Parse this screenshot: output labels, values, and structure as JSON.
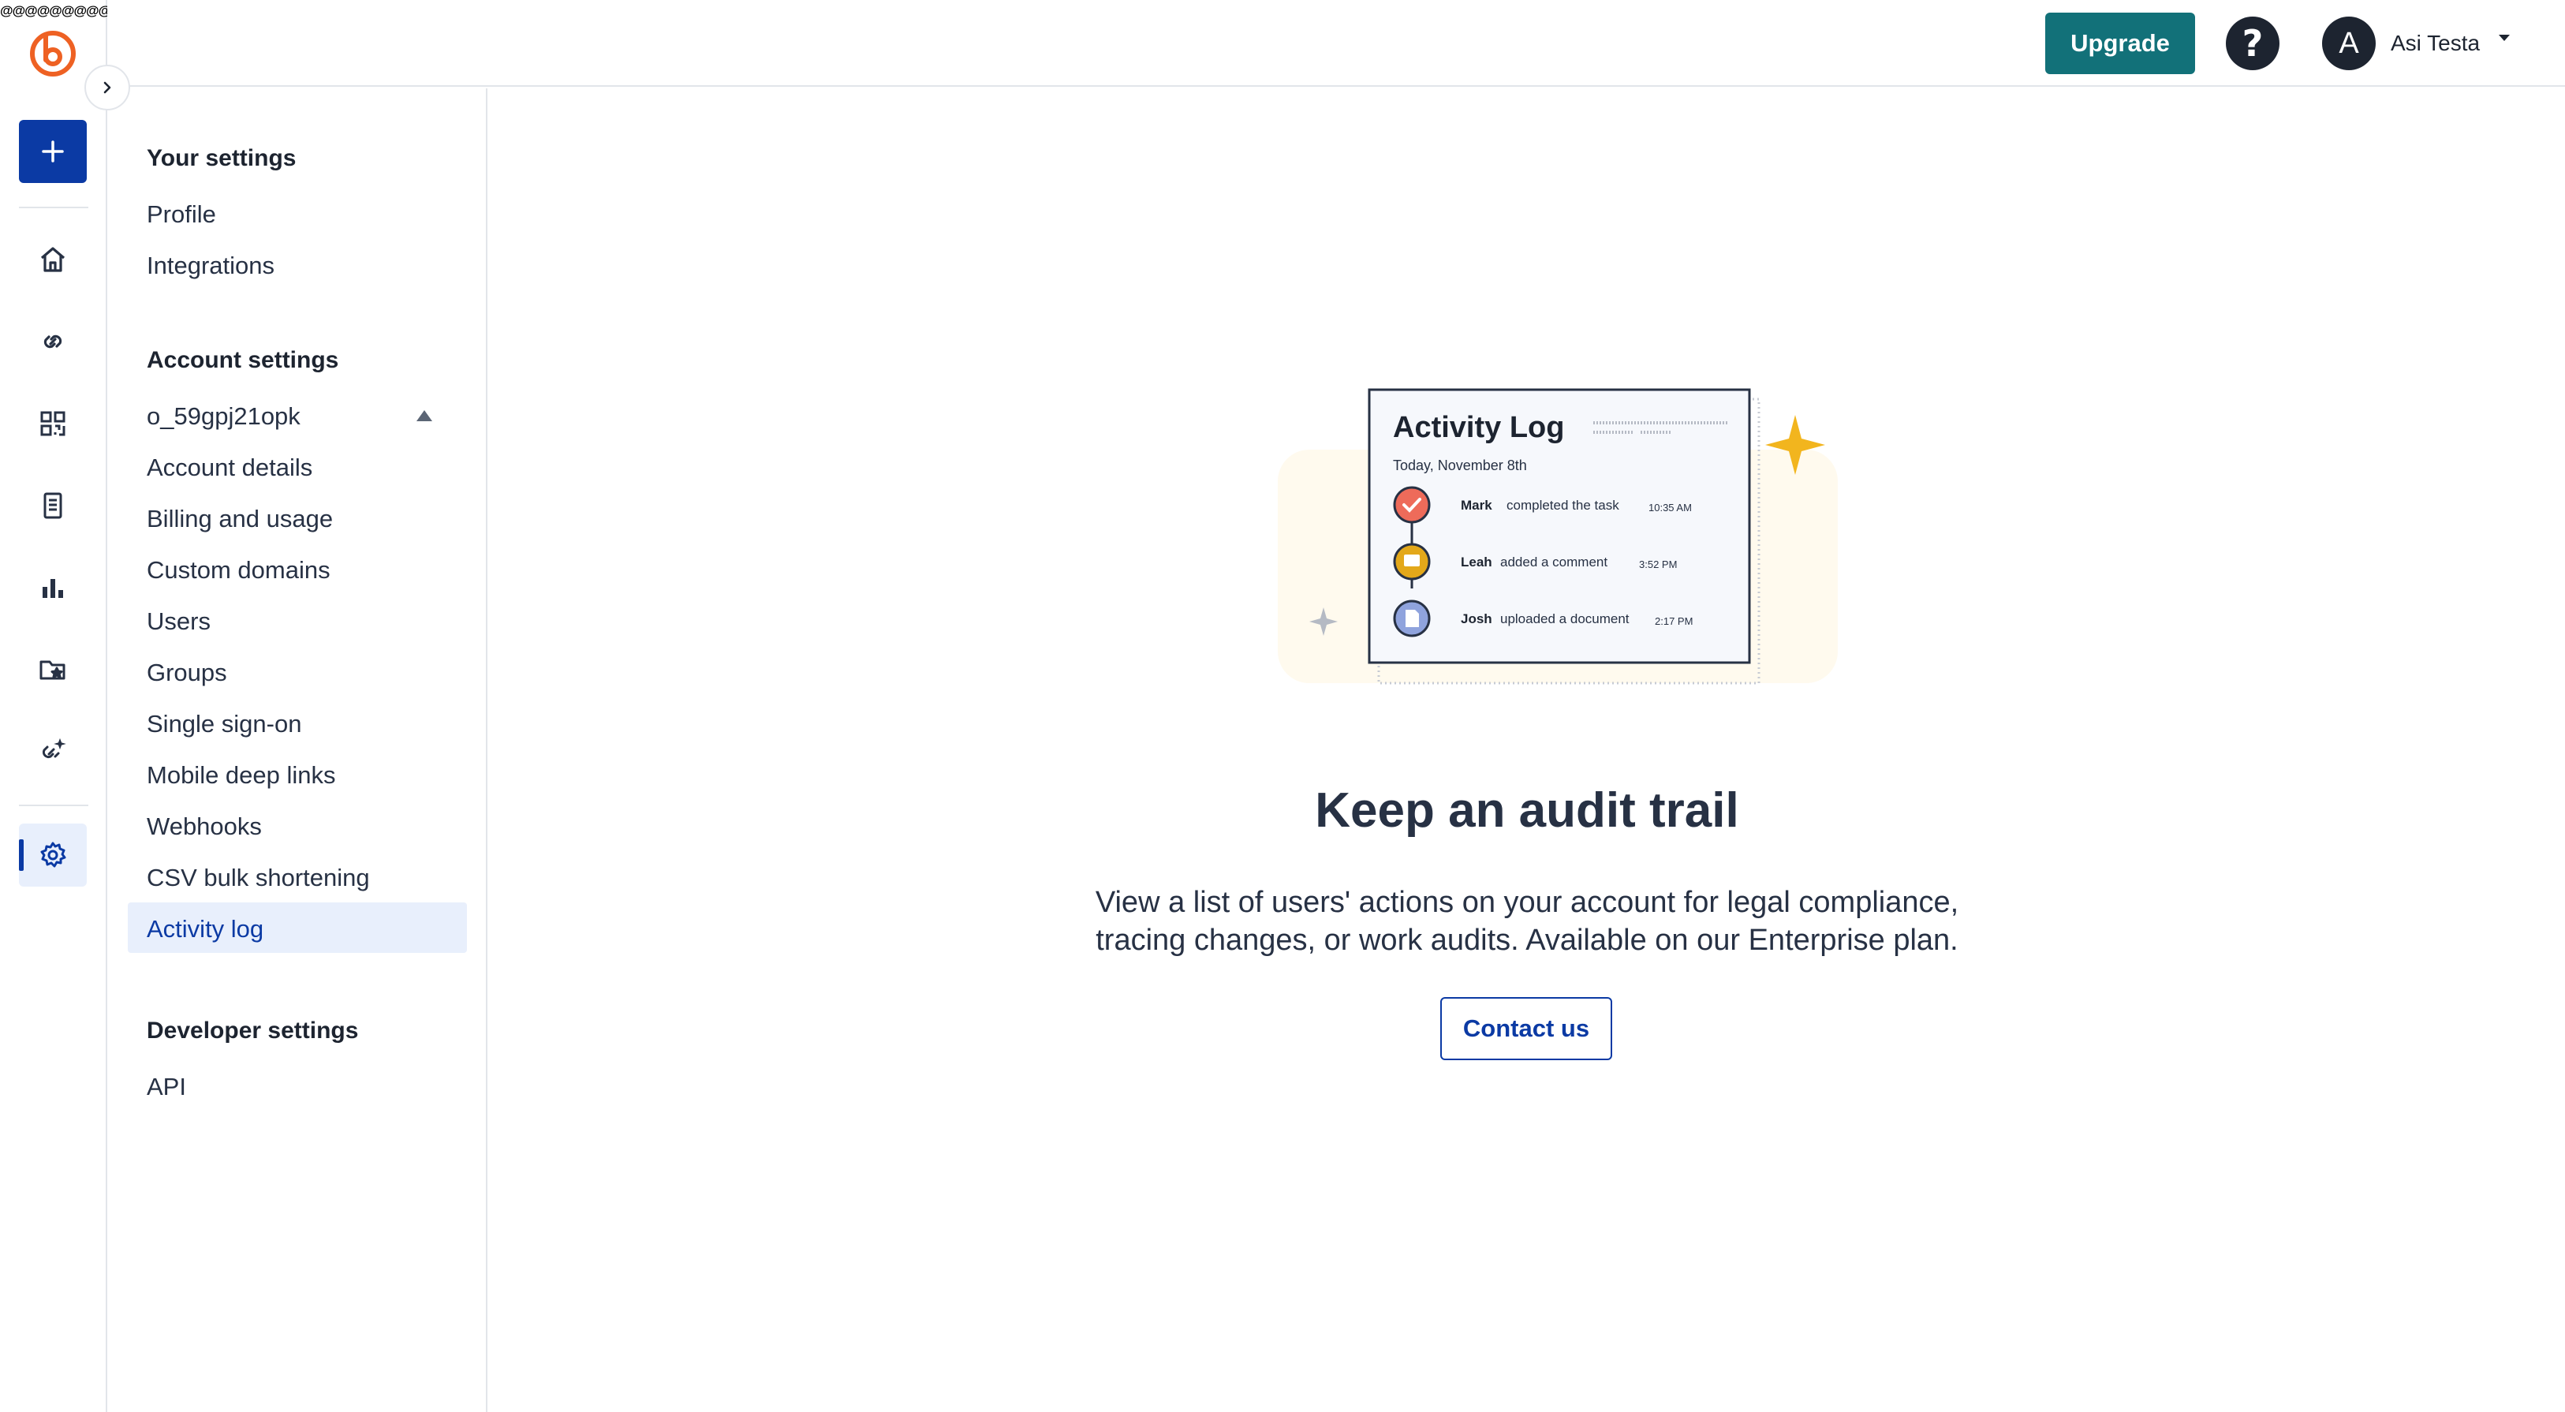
{
  "topbar": {
    "upgrade_label": "Upgrade",
    "help_glyph": "?",
    "avatar_initial": "A",
    "user_name": "Asi Testa"
  },
  "rail": {
    "scribble_text": "@@@@@@@@@@",
    "brand_color": "#ee6123",
    "icons": [
      "home-icon",
      "link-icon",
      "qr-code-icon",
      "pages-icon",
      "analytics-icon",
      "campaigns-icon",
      "custom-links-icon",
      "settings-icon"
    ]
  },
  "settings_nav": {
    "your_settings_heading": "Your settings",
    "your_settings_items": [
      "Profile",
      "Integrations"
    ],
    "account_settings_heading": "Account settings",
    "account_name": "o_59gpj21opk",
    "account_items": [
      "Account details",
      "Billing and usage",
      "Custom domains",
      "Users",
      "Groups",
      "Single sign-on",
      "Mobile deep links",
      "Webhooks",
      "CSV bulk shortening",
      "Activity log"
    ],
    "active_item": "Activity log",
    "developer_settings_heading": "Developer settings",
    "developer_items": [
      "API"
    ]
  },
  "illustration": {
    "title": "Activity Log",
    "date": "Today, November 8th",
    "entries": [
      {
        "name": "Mark",
        "action": "completed the task",
        "time": "10:35 AM",
        "color": "#ee6b5a"
      },
      {
        "name": "Leah",
        "action": "added a comment",
        "time": "3:52 PM",
        "color": "#e3a81a"
      },
      {
        "name": "Josh",
        "action": "uploaded a document",
        "time": "2:17 PM",
        "color": "#8fa3dd"
      }
    ]
  },
  "main": {
    "headline": "Keep an audit trail",
    "description_line1": "View a list of users' actions on your account for legal compliance,",
    "description_line2": "tracing changes, or work audits. Available on our Enterprise plan.",
    "contact_label": "Contact us"
  },
  "colors": {
    "accent": "#0b3aa4",
    "upgrade": "#127179",
    "active_bg": "#e8effc",
    "star": "#f2b51e"
  }
}
